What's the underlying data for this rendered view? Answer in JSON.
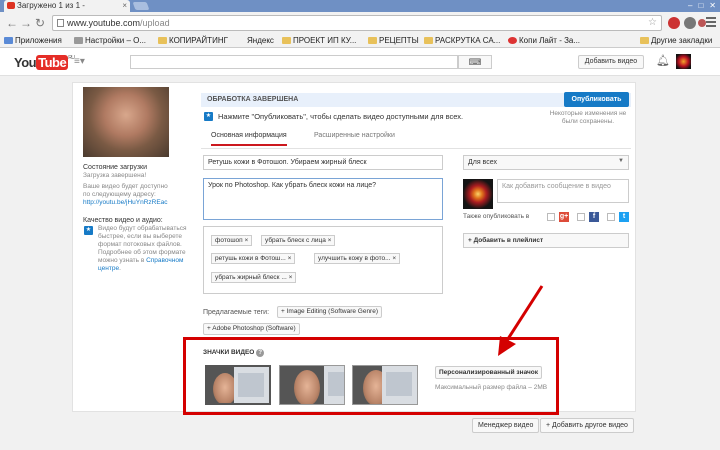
{
  "browser": {
    "tab_title": "Загружено 1 из 1 -",
    "tab_close": "×",
    "url_host": "www.youtube.com",
    "url_path": "/upload",
    "bookmarks": [
      "Приложения",
      "Настройки – О...",
      "КОПИРАЙТИНГ",
      "Яндекс",
      "ПРОЕКТ ИП КУ...",
      "РЕЦЕПТЫ",
      "РАСКРУТКА СА...",
      "Копи Лайт - За..."
    ],
    "other_bookmarks": "Другие закладки",
    "icons": [
      "back-icon",
      "forward-icon",
      "reload-icon",
      "bookmark-star-icon",
      "menu-icon"
    ]
  },
  "header": {
    "logo_you": "You",
    "logo_tube": "Tube",
    "logo_ru": "RU",
    "upload_button": "Добавить видео"
  },
  "left": {
    "status_title": "Состояние загрузки",
    "status_value": "Загрузка завершена!",
    "available_text": "Ваше видео будет доступно по следующему адресу:",
    "video_link": "http://youtu.be/jHuYnRzREac",
    "quality_title": "Качество видео и аудио:",
    "quality_text_1": "Видео будут обрабатываться быстрее, если вы выберете формат потоковых файлов. Подробнее об этом формате можно узнать в ",
    "quality_link": "Справочном центре",
    "quality_text_2": "."
  },
  "main": {
    "status_bar": "ОБРАБОТКА ЗАВЕРШЕНА",
    "publish_button": "Опубликовать",
    "hint": "Нажмите \"Опубликовать\", чтобы сделать видео доступными для всех.",
    "unsaved_note": "Некоторые изменения не были сохранены.",
    "tab_basic": "Основная информация",
    "tab_advanced": "Расширенные настройки",
    "title_value": "Ретушь кожи в Фотошоп. Убираем жирный блеск",
    "description_value": "Урок по Photoshop. Как убрать блеск кожи на лице?",
    "tags": [
      "фотошоп",
      "убрать блеск с лица",
      "ретушь кожи в Фотош...",
      "улучшить кожу в фото...",
      "убрать жирный блеск ..."
    ],
    "tag_remove": "×",
    "suggested_label": "Предлагаемые теги:",
    "suggested_tags": [
      "+ Image Editing (Software Genre)",
      "+ Adobe Photoshop (Software)"
    ],
    "thumbnails_label": "ЗНАЧКИ ВИДЕО",
    "custom_thumb_button": "Персонализированный значок",
    "max_size": "Максимальный размер файла – 2MB"
  },
  "right": {
    "privacy": "Для всех",
    "message_placeholder": "Как добавить сообщение в видео",
    "also_publish": "Также опубликовать в",
    "add_playlist": "+ Добавить в плейлист"
  },
  "footer": {
    "manager_button": "Менеджер видео",
    "add_another_button": "+ Добавить другое видео"
  },
  "colors": {
    "accent": "#167ac6",
    "annotation_red": "#d40000",
    "tab_underline": "#cc181e"
  }
}
